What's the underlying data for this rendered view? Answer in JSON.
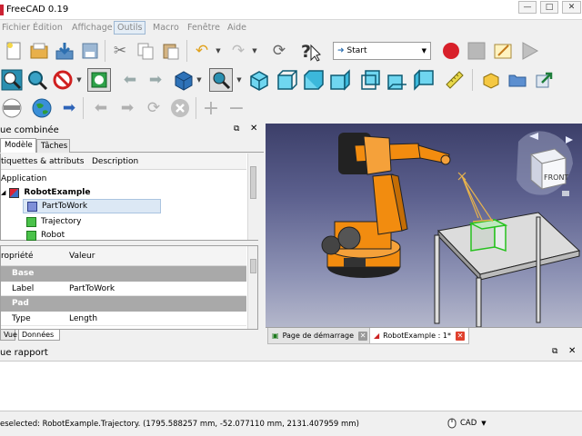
{
  "window": {
    "title": "FreeCAD 0.19"
  },
  "menu": [
    "Fichier",
    "Édition",
    "Affichage",
    "Outils",
    "Macro",
    "Fenêtre",
    "Aide"
  ],
  "toolbar": {
    "macro_combo_value": "Start"
  },
  "combined_view": {
    "title": "ue combinée",
    "tabs": [
      "Modèle",
      "Tâches"
    ],
    "tree_columns": [
      "tiquettes & attributs",
      "Description"
    ],
    "tree_root": "Application",
    "document": "RobotExample",
    "items": [
      "PartToWork",
      "Trajectory",
      "Robot"
    ],
    "bottom_tabs": [
      "Vue",
      "Données"
    ]
  },
  "properties": {
    "columns": [
      "ropriété",
      "Valeur"
    ],
    "groups": [
      {
        "name": "Base",
        "rows": [
          {
            "name": "Label",
            "value": "PartToWork"
          }
        ]
      },
      {
        "name": "Pad",
        "rows": [
          {
            "name": "Type",
            "value": "Length"
          }
        ]
      }
    ]
  },
  "document_tabs": [
    "Page de démarrage",
    "RobotExample : 1*"
  ],
  "report_view": {
    "title": "ue rapport"
  },
  "status": {
    "text": "eselected: RobotExample.Trajectory. (1795.588257 mm, -52.077110 mm, 2131.407959 mm)",
    "nav_style": "CAD"
  },
  "colors": {
    "robot_orange": "#f28c0f",
    "selection_green": "#27c21f",
    "trajectory_yellow": "#e6b24e",
    "viewport_top": "#3c3f69",
    "viewport_bottom": "#b4b7cb"
  },
  "icons": [
    "new-document-icon",
    "open-icon",
    "save-icon",
    "cut-icon",
    "copy-icon",
    "paste-icon",
    "undo-icon",
    "redo-icon",
    "refresh-icon",
    "whats-this-icon",
    "record-macro-icon",
    "stop-macro-icon",
    "edit-macro-icon",
    "run-macro-icon",
    "fit-all-icon",
    "fit-selection-icon",
    "draw-style-icon",
    "bounding-box-icon",
    "back-icon",
    "forward-icon",
    "std-views-icon",
    "zoom-icon",
    "isometric-icon",
    "front-view-icon",
    "top-view-icon",
    "right-view-icon",
    "rear-view-icon",
    "bottom-view-icon",
    "left-view-icon",
    "measure-icon",
    "part-icon",
    "folder-icon",
    "link-icon",
    "web-icon",
    "globe-icon",
    "go-icon",
    "nav-back-icon",
    "nav-forward-icon",
    "nav-refresh-icon",
    "nav-stop-icon",
    "zoom-in-icon",
    "zoom-out-icon"
  ]
}
